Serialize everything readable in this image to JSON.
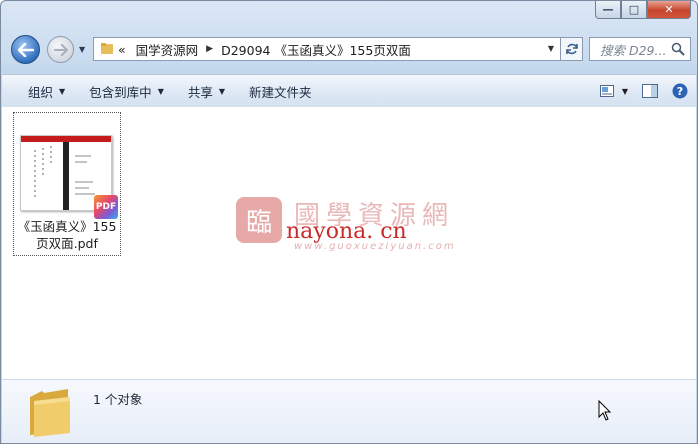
{
  "window": {
    "caption": {
      "minimize": "—",
      "maximize": "□",
      "close": "✕"
    }
  },
  "address_bar": {
    "overflow": "«",
    "crumbs": [
      "国学资源网",
      "D29094 《玉函真义》155页双面"
    ],
    "refresh_icon": "refresh-icon"
  },
  "search": {
    "placeholder": "搜索 D29..."
  },
  "toolbar": {
    "organize": "组织",
    "include_in_library": "包含到库中",
    "share": "共享",
    "new_folder": "新建文件夹"
  },
  "files": [
    {
      "name": "《玉函真义》155页双面.pdf",
      "badge": "PDF",
      "thumb_header": "PDF"
    }
  ],
  "watermark": {
    "seal": "臨",
    "title": "國學資源網",
    "url": "nayona. cn",
    "sub": "www.guoxueziyuan.com"
  },
  "details": {
    "count": "1 个对象"
  },
  "colors": {
    "accent": "#2f6fc0",
    "close": "#c7452e",
    "watermark_red": "#c92a2a"
  }
}
